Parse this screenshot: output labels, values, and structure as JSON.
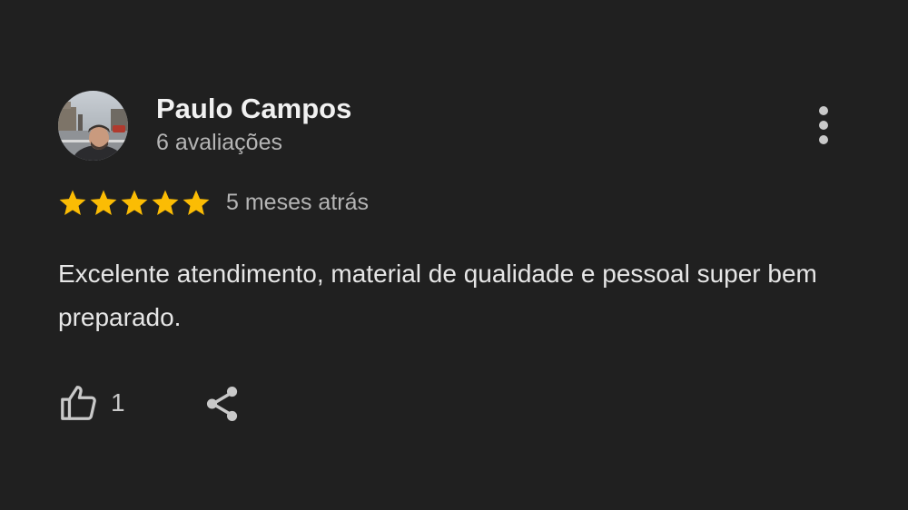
{
  "review": {
    "author": "Paulo Campos",
    "review_count": "6 avaliações",
    "rating": 5,
    "rating_max": 5,
    "date": "5 meses atrás",
    "text": "Excelente atendimento, material de qualidade e pessoal super bem preparado.",
    "likes": "1"
  },
  "icons": {
    "avatar": "user-photo",
    "more": "more-vertical-icon",
    "star": "star-icon",
    "like": "thumbs-up-icon",
    "share": "share-icon"
  },
  "colors": {
    "background": "#202020",
    "star": "#fbbc04",
    "primary_text": "#f1f1f1",
    "secondary_text": "#b5b5b5",
    "icon": "#c9c9c9"
  }
}
